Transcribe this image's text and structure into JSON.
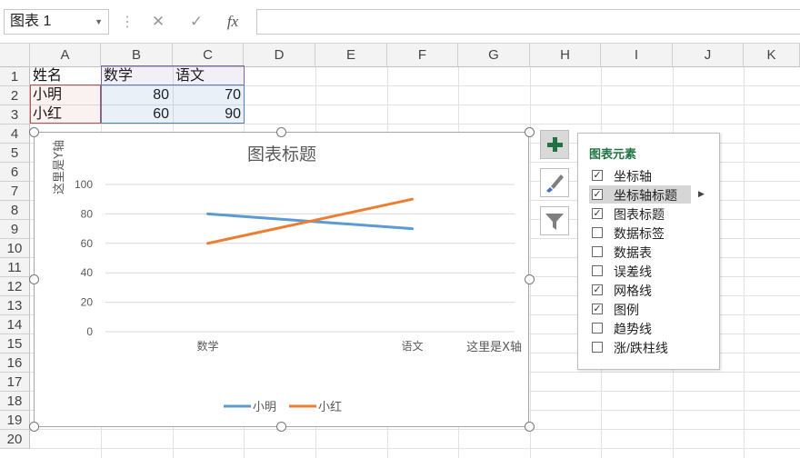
{
  "formula_bar": {
    "name_box": "图表 1",
    "cancel_icon": "✕",
    "confirm_icon": "✓",
    "fx_icon": "fx"
  },
  "columns": [
    "A",
    "B",
    "C",
    "D",
    "E",
    "F",
    "G",
    "H",
    "I",
    "J",
    "K"
  ],
  "rows": [
    "1",
    "2",
    "3",
    "4",
    "5",
    "6",
    "7",
    "8",
    "9",
    "10",
    "11",
    "12",
    "13",
    "14",
    "15",
    "16",
    "17",
    "18",
    "19",
    "20"
  ],
  "cells": {
    "a1": "姓名",
    "b1": "数学",
    "c1": "语文",
    "a2": "小明",
    "b2": "80",
    "c2": "70",
    "a3": "小红",
    "b3": "60",
    "c3": "90"
  },
  "chart_data": {
    "type": "line",
    "title": "图表标题",
    "xlabel": "这里是X轴",
    "ylabel": "这里是Y轴",
    "categories": [
      "数学",
      "语文"
    ],
    "ylim": [
      0,
      100
    ],
    "yticks": [
      "0",
      "20",
      "40",
      "60",
      "80",
      "100"
    ],
    "grid": true,
    "legend_position": "bottom",
    "series": [
      {
        "name": "小明",
        "values": [
          80,
          70
        ],
        "color": "#5b9bd5"
      },
      {
        "name": "小红",
        "values": [
          60,
          90
        ],
        "color": "#ed7d31"
      }
    ]
  },
  "side_buttons": {
    "add": "plus-icon",
    "style": "brush-icon",
    "filter": "filter-icon"
  },
  "chart_elements_panel": {
    "title": "图表元素",
    "options": [
      {
        "label": "坐标轴",
        "checked": true
      },
      {
        "label": "坐标轴标题",
        "checked": true,
        "highlighted": true
      },
      {
        "label": "图表标题",
        "checked": true
      },
      {
        "label": "数据标签",
        "checked": false
      },
      {
        "label": "数据表",
        "checked": false
      },
      {
        "label": "误差线",
        "checked": false
      },
      {
        "label": "网格线",
        "checked": true
      },
      {
        "label": "图例",
        "checked": true
      },
      {
        "label": "趋势线",
        "checked": false
      },
      {
        "label": "涨/跌柱线",
        "checked": false
      }
    ]
  }
}
